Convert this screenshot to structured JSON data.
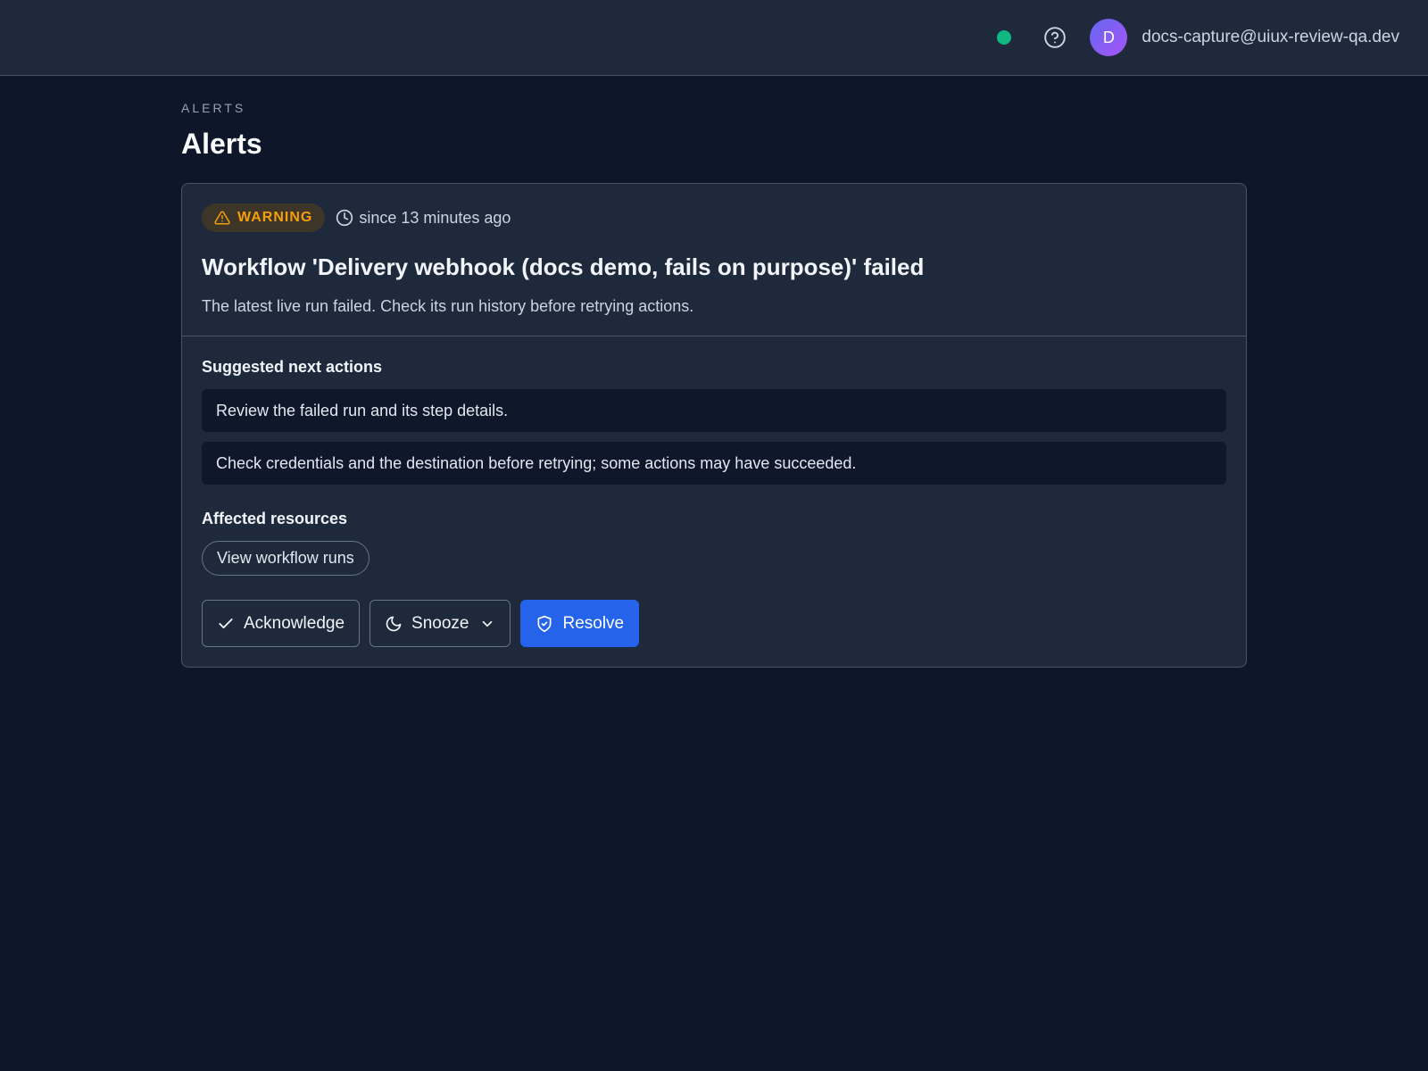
{
  "header": {
    "status_color": "#10b981",
    "help_icon": "help-circle-icon",
    "avatar_initial": "D",
    "user_email": "docs-capture@uiux-review-qa.dev"
  },
  "page": {
    "eyebrow": "ALERTS",
    "title": "Alerts"
  },
  "alert": {
    "severity_label": "WARNING",
    "severity_color": "#f59e0b",
    "since_text": "since 13 minutes ago",
    "title": "Workflow 'Delivery webhook (docs demo, fails on purpose)' failed",
    "description": "The latest live run failed. Check its run history before retrying actions.",
    "suggested_heading": "Suggested next actions",
    "suggested_actions": [
      "Review the failed run and its step details.",
      "Check credentials and the destination before retrying; some actions may have succeeded."
    ],
    "affected_heading": "Affected resources",
    "affected_link": "View workflow runs",
    "buttons": {
      "acknowledge": "Acknowledge",
      "snooze": "Snooze",
      "resolve": "Resolve"
    },
    "primary_color": "#2563eb"
  }
}
